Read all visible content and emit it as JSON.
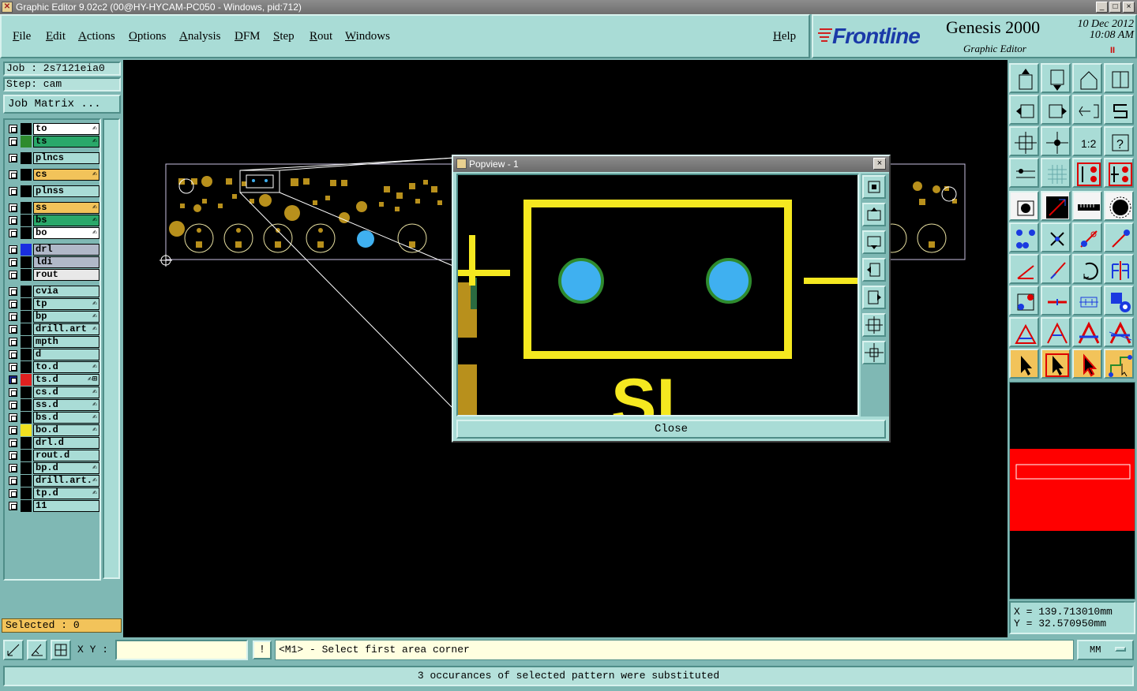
{
  "window": {
    "title": "Graphic Editor 9.02c2 (00@HY-HYCAM-PC050 - Windows, pid:712)",
    "controls": [
      "_",
      "□",
      "×"
    ]
  },
  "menu": {
    "items": [
      "File",
      "Edit",
      "Actions",
      "Options",
      "Analysis",
      "DFM",
      "Step",
      "Rout",
      "Windows"
    ],
    "help": "Help"
  },
  "brand": {
    "logo": "Frontline",
    "product": "Genesis 2000",
    "subtitle": "Graphic Editor",
    "date": "10 Dec 2012",
    "time": "10:08 AM",
    "pause": "II"
  },
  "job": {
    "job_label": "Job : 2s7121eia0",
    "step_label": "Step: cam",
    "matrix_button": "Job Matrix ..."
  },
  "layers": [
    {
      "name": "to",
      "color": "#000000",
      "fill": "#ffffff",
      "flag": "✍"
    },
    {
      "name": "ts",
      "color": "#2e8b2e",
      "fill": "#2aa86a",
      "flag": "✍"
    },
    {
      "name": "plncs",
      "color": "#000000",
      "fill": "#a9dcd6",
      "flag": ""
    },
    {
      "name": "cs",
      "color": "#000000",
      "fill": "#f2c35a",
      "flag": "✍"
    },
    {
      "name": "plnss",
      "color": "#000000",
      "fill": "#a9dcd6",
      "flag": ""
    },
    {
      "name": "ss",
      "color": "#000000",
      "fill": "#f2c35a",
      "flag": "✍"
    },
    {
      "name": "bs",
      "color": "#000000",
      "fill": "#2aa86a",
      "flag": "✍"
    },
    {
      "name": "bo",
      "color": "#000000",
      "fill": "#ffffff",
      "flag": "✍"
    },
    {
      "name": "drl",
      "color": "#1a2ee0",
      "fill": "#b0b8c8",
      "flag": ""
    },
    {
      "name": "ldi",
      "color": "#000000",
      "fill": "#b0b8c8",
      "flag": ""
    },
    {
      "name": "rout",
      "color": "#000000",
      "fill": "#e8e8e8",
      "flag": ""
    },
    {
      "name": "cvia",
      "color": "#000000",
      "fill": "#a9dcd6",
      "flag": ""
    },
    {
      "name": "tp",
      "color": "#000000",
      "fill": "#a9dcd6",
      "flag": "✍"
    },
    {
      "name": "bp",
      "color": "#000000",
      "fill": "#a9dcd6",
      "flag": "✍"
    },
    {
      "name": "drill.art",
      "color": "#000000",
      "fill": "#a9dcd6",
      "flag": "✍"
    },
    {
      "name": "mpth",
      "color": "#000000",
      "fill": "#a9dcd6",
      "flag": ""
    },
    {
      "name": "d",
      "color": "#000000",
      "fill": "#a9dcd6",
      "flag": ""
    },
    {
      "name": "to.d",
      "color": "#000000",
      "fill": "#a9dcd6",
      "flag": "✍"
    },
    {
      "name": "ts.d",
      "color": "#e02020",
      "fill": "#a9dcd6",
      "flag": "✍⊞"
    },
    {
      "name": "cs.d",
      "color": "#000000",
      "fill": "#a9dcd6",
      "flag": "✍"
    },
    {
      "name": "ss.d",
      "color": "#000000",
      "fill": "#a9dcd6",
      "flag": "✍"
    },
    {
      "name": "bs.d",
      "color": "#000000",
      "fill": "#a9dcd6",
      "flag": "✍"
    },
    {
      "name": "bo.d",
      "color": "#f0e020",
      "fill": "#a9dcd6",
      "flag": "✍"
    },
    {
      "name": "drl.d",
      "color": "#000000",
      "fill": "#a9dcd6",
      "flag": ""
    },
    {
      "name": "rout.d",
      "color": "#000000",
      "fill": "#a9dcd6",
      "flag": ""
    },
    {
      "name": "bp.d",
      "color": "#000000",
      "fill": "#a9dcd6",
      "flag": "✍"
    },
    {
      "name": "drill.art.",
      "color": "#000000",
      "fill": "#a9dcd6",
      "flag": "✍"
    },
    {
      "name": "tp.d",
      "color": "#000000",
      "fill": "#a9dcd6",
      "flag": "✍"
    },
    {
      "name": "11",
      "color": "#000000",
      "fill": "#a9dcd6",
      "flag": ""
    }
  ],
  "selected": "Selected : 0",
  "popview": {
    "title": "Popview - 1",
    "close_x": "×",
    "close_button": "Close",
    "silk_text": "SL"
  },
  "coords": {
    "x": "X = 139.713010mm",
    "y": "Y = 32.570950mm"
  },
  "command": {
    "xy_label": "X Y :",
    "xy_value": "",
    "exclaim": "!",
    "prompt": "<M1> - Select first area corner",
    "units": "MM"
  },
  "status": "3 occurances of selected pattern were substituted",
  "colors": {
    "panel": "#a9dcd6",
    "panel_dark": "#7fb8b4",
    "pad_copper": "#b8901c",
    "silk": "#f5e820",
    "drill_blue": "#3fb0f0",
    "minimap_red": "#ff0000"
  }
}
